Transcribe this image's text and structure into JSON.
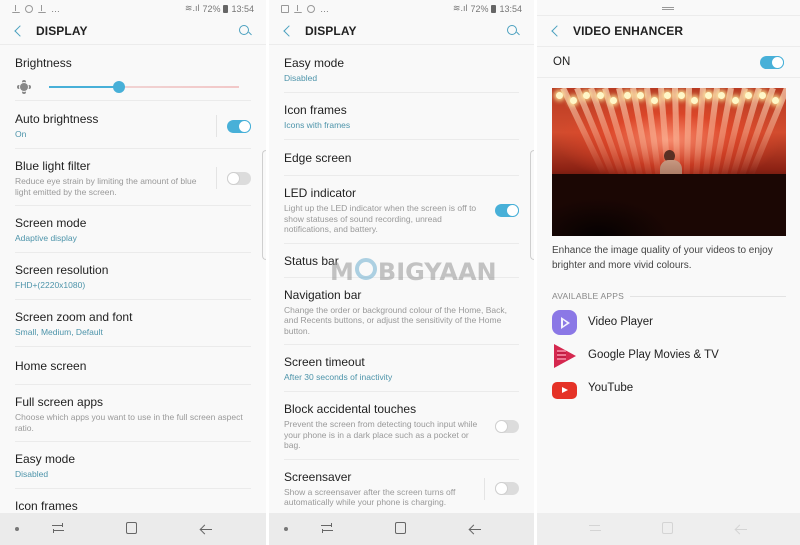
{
  "status_bar": {
    "battery": "72%",
    "time": "13:54"
  },
  "colors": {
    "accent": "#48b0d8",
    "subtext_accent": "#4d94aa",
    "youtube_red": "#e53227",
    "video_player_purple": "#8b78e6",
    "play_movies_red": "#d5284f"
  },
  "panel1": {
    "title": "DISPLAY",
    "brightness": {
      "label": "Brightness",
      "level": 0.37
    },
    "items": [
      {
        "label": "Auto brightness",
        "sub": "On",
        "toggle": "on"
      },
      {
        "label": "Blue light filter",
        "desc": "Reduce eye strain by limiting the amount of blue light emitted by the screen.",
        "toggle": "off"
      },
      {
        "label": "Screen mode",
        "sub": "Adaptive display"
      },
      {
        "label": "Screen resolution",
        "sub": "FHD+(2220x1080)"
      },
      {
        "label": "Screen zoom and font",
        "sub": "Small, Medium, Default"
      },
      {
        "label": "Home screen"
      },
      {
        "label": "Full screen apps",
        "desc": "Choose which apps you want to use in the full screen aspect ratio."
      },
      {
        "label": "Easy mode",
        "sub": "Disabled"
      },
      {
        "label": "Icon frames"
      }
    ]
  },
  "panel2": {
    "title": "DISPLAY",
    "items": [
      {
        "label": "Easy mode",
        "sub": "Disabled"
      },
      {
        "label": "Icon frames",
        "sub": "Icons with frames"
      },
      {
        "label": "Edge screen"
      },
      {
        "label": "LED indicator",
        "desc": "Light up the LED indicator when the screen is off to show statuses of sound recording, unread notifications, and battery.",
        "toggle": "on"
      },
      {
        "label": "Status bar"
      },
      {
        "label": "Navigation bar",
        "desc": "Change the order or background colour of the Home, Back, and Recents buttons, or adjust the sensitivity of the Home button."
      },
      {
        "label": "Screen timeout",
        "sub": "After 30 seconds of inactivity"
      },
      {
        "label": "Block accidental touches",
        "desc": "Prevent the screen from detecting touch input while your phone is in a dark place such as a pocket or bag.",
        "toggle": "off"
      },
      {
        "label": "Screensaver",
        "desc": "Show a screensaver after the screen turns off automatically while your phone is charging.",
        "toggle": "off"
      }
    ]
  },
  "panel3": {
    "title": "VIDEO ENHANCER",
    "master_label": "ON",
    "master_toggle": "on",
    "preview_alt": "concert crowd",
    "caption": "Enhance the image quality of your videos to enjoy brighter and more vivid colours.",
    "section": "AVAILABLE APPS",
    "apps": [
      {
        "name": "Video Player",
        "icon": "video-player-icon"
      },
      {
        "name": "Google Play Movies & TV",
        "icon": "play-movies-icon"
      },
      {
        "name": "YouTube",
        "icon": "youtube-icon"
      }
    ]
  },
  "watermark": "MOBIGYAAN"
}
